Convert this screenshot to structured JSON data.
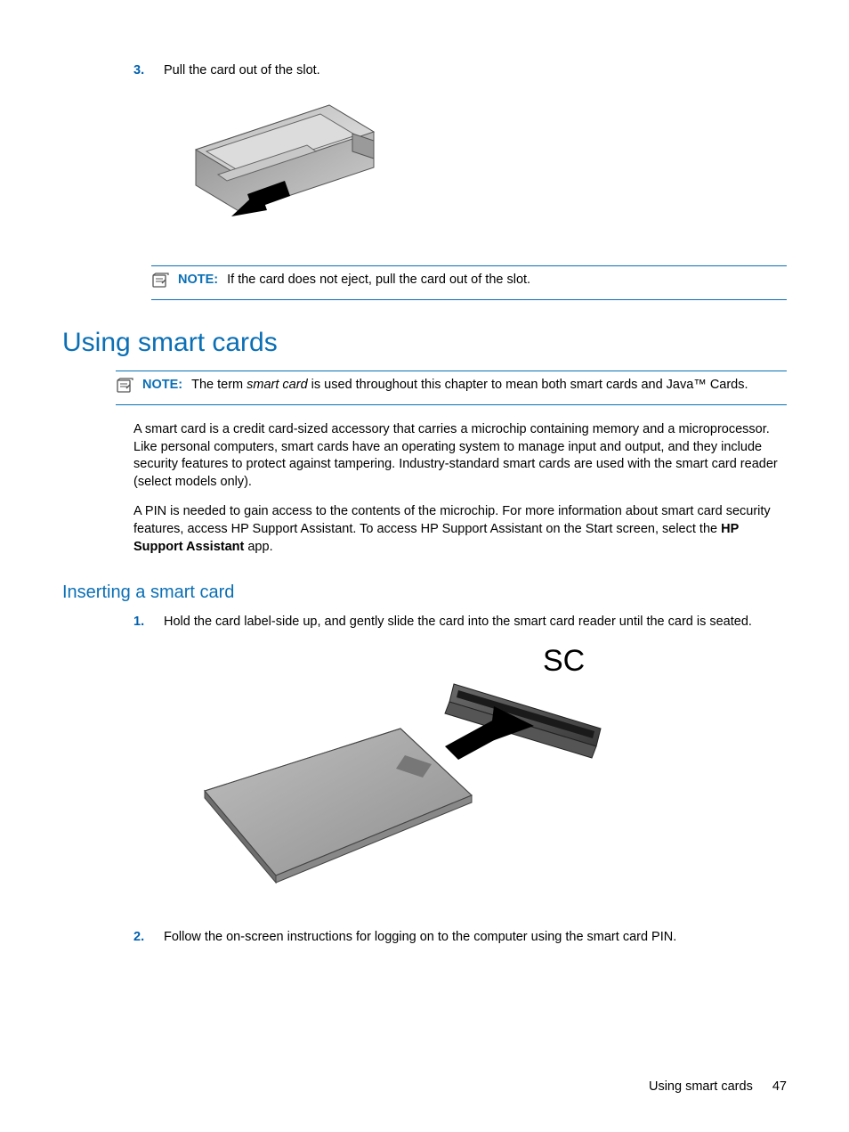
{
  "step3": {
    "num": "3.",
    "text": "Pull the card out of the slot."
  },
  "note1": {
    "label": "NOTE:",
    "text": "If the card does not eject, pull the card out of the slot."
  },
  "h1": "Using smart cards",
  "note2": {
    "label": "NOTE:",
    "pre": "The term ",
    "italic": "smart card",
    "post": " is used throughout this chapter to mean both smart cards and Java™ Cards."
  },
  "para1": "A smart card is a credit card-sized accessory that carries a microchip containing memory and a microprocessor. Like personal computers, smart cards have an operating system to manage input and output, and they include security features to protect against tampering. Industry-standard smart cards are used with the smart card reader (select models only).",
  "para2": {
    "pre": "A PIN is needed to gain access to the contents of the microchip. For more information about smart card security features, access HP Support Assistant. To access HP Support Assistant on the Start screen, select the ",
    "bold": "HP Support Assistant",
    "post": " app."
  },
  "h2": "Inserting a smart card",
  "step1b": {
    "num": "1.",
    "text": "Hold the card label-side up, and gently slide the card into the smart card reader until the card is seated."
  },
  "fig2label": "SC",
  "step2b": {
    "num": "2.",
    "text": "Follow the on-screen instructions for logging on to the computer using the smart card PIN."
  },
  "footer": {
    "title": "Using smart cards",
    "page": "47"
  }
}
